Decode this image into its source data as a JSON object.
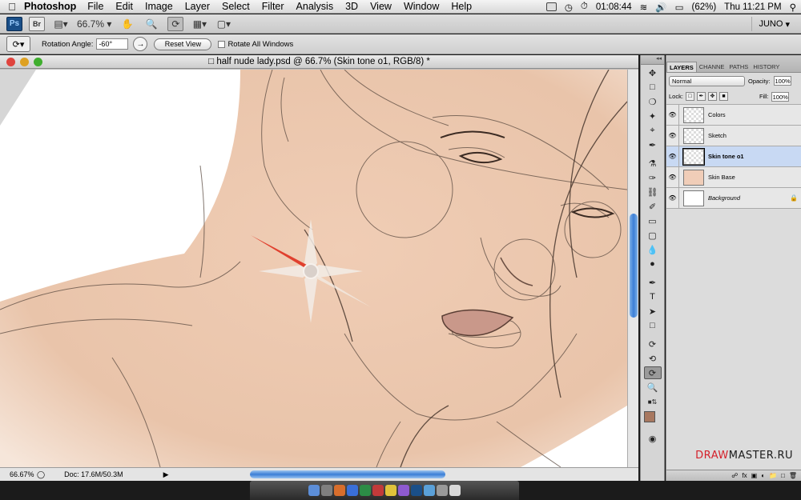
{
  "menubar": {
    "app": "Photoshop",
    "items": [
      "File",
      "Edit",
      "Image",
      "Layer",
      "Select",
      "Filter",
      "Analysis",
      "3D",
      "View",
      "Window",
      "Help"
    ],
    "clock_timer": "01:08:44",
    "battery": "(62%)",
    "datetime": "Thu 11:21 PM"
  },
  "appbar": {
    "ps_label": "Ps",
    "br_label": "Br",
    "zoom": "66.7%",
    "workspace": "JUNO"
  },
  "options": {
    "rotation_label": "Rotation Angle:",
    "rotation_value": "-60°",
    "reset_label": "Reset View",
    "rotate_all_label": "Rotate All Windows"
  },
  "document": {
    "title": "half nude lady.psd @ 66.7% (Skin tone o1, RGB/8) *",
    "zoom": "66.67%",
    "doc_size": "Doc: 17.6M/50.3M"
  },
  "layers_panel": {
    "tabs": [
      "LAYERS",
      "CHANNE",
      "PATHS",
      "HISTORY"
    ],
    "blend_mode": "Normal",
    "opacity_label": "Opacity:",
    "opacity": "100%",
    "lock_label": "Lock:",
    "fill_label": "Fill:",
    "fill": "100%",
    "layers": [
      {
        "name": "Colors"
      },
      {
        "name": "Sketch"
      },
      {
        "name": "Skin tone o1"
      },
      {
        "name": "Skin Base"
      },
      {
        "name": "Background"
      }
    ]
  },
  "watermark": {
    "text_left": "DRAW",
    "text_right": "MASTER.RU"
  },
  "colors": {
    "skin": "#ecc8af",
    "foreground": "#a87860",
    "selection": "#c8d9f3",
    "compass_red": "#e0402e"
  }
}
